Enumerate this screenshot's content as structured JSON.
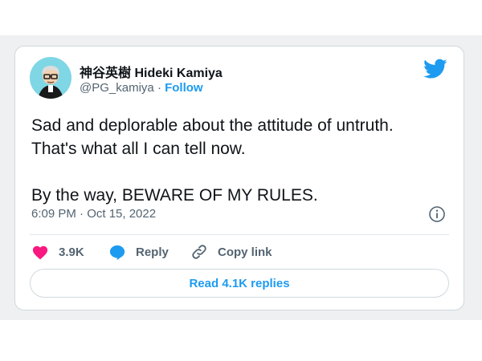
{
  "tweet": {
    "author": {
      "display_name": "神谷英樹 Hideki Kamiya",
      "handle": "@PG_kamiya",
      "separator": "·",
      "follow_label": "Follow"
    },
    "text_lines": [
      "Sad and deplorable about the attitude of untruth.",
      "That's what all I can tell now.",
      "By the way, BEWARE OF MY RULES."
    ],
    "timestamp": "6:09 PM · Oct 15, 2022",
    "actions": {
      "like_count": "3.9K",
      "reply_label": "Reply",
      "copy_link_label": "Copy link"
    },
    "read_replies_label": "Read 4.1K replies"
  },
  "icons": {
    "brand": "twitter-bird-icon",
    "info": "info-icon",
    "like": "heart-icon",
    "reply": "reply-bubble-icon",
    "copy": "link-icon"
  },
  "colors": {
    "accent": "#1d9bf0",
    "like": "#f91880",
    "text": "#0f1419",
    "muted": "#536471",
    "avatar_bg": "#7fd6e5"
  }
}
